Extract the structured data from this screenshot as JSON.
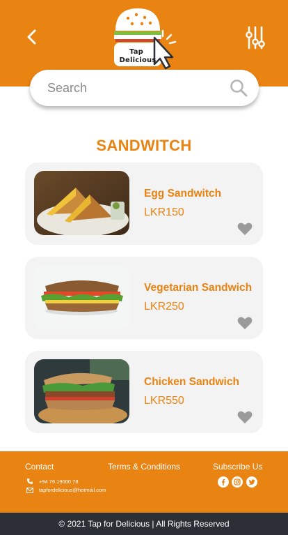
{
  "header": {
    "brand_line1": "Tap",
    "brand_line2": "Delicious",
    "back_icon": "chevron-left-icon",
    "filter_icon": "sliders-icon",
    "background_color": "#e98312"
  },
  "search": {
    "placeholder": "Search",
    "icon": "search-icon"
  },
  "section_title": "SANDWITCH",
  "products": [
    {
      "name": "Egg Sandwitch",
      "price": "LKR150",
      "favorite_icon": "heart-icon"
    },
    {
      "name": "Vegetarian Sandwich",
      "price": "LKR250",
      "favorite_icon": "heart-icon"
    },
    {
      "name": "Chicken Sandwich",
      "price": "LKR550",
      "favorite_icon": "heart-icon"
    }
  ],
  "footer": {
    "contact_label": "Contact",
    "phone": "+94 76 19000 78",
    "email": "tapfordelicious@hotmail.com",
    "terms_label": "Terms & Conditions",
    "subscribe_label": "Subscribe Us",
    "social_icons": [
      "facebook-icon",
      "instagram-icon",
      "twitter-icon"
    ]
  },
  "copyright": "© 2021 Tap for Delicious | All Rights Reserved",
  "colors": {
    "accent": "#e98312",
    "card_background": "#f3f3f3",
    "footer_bar": "#2d2f37",
    "heart": "#9a9a9a"
  }
}
